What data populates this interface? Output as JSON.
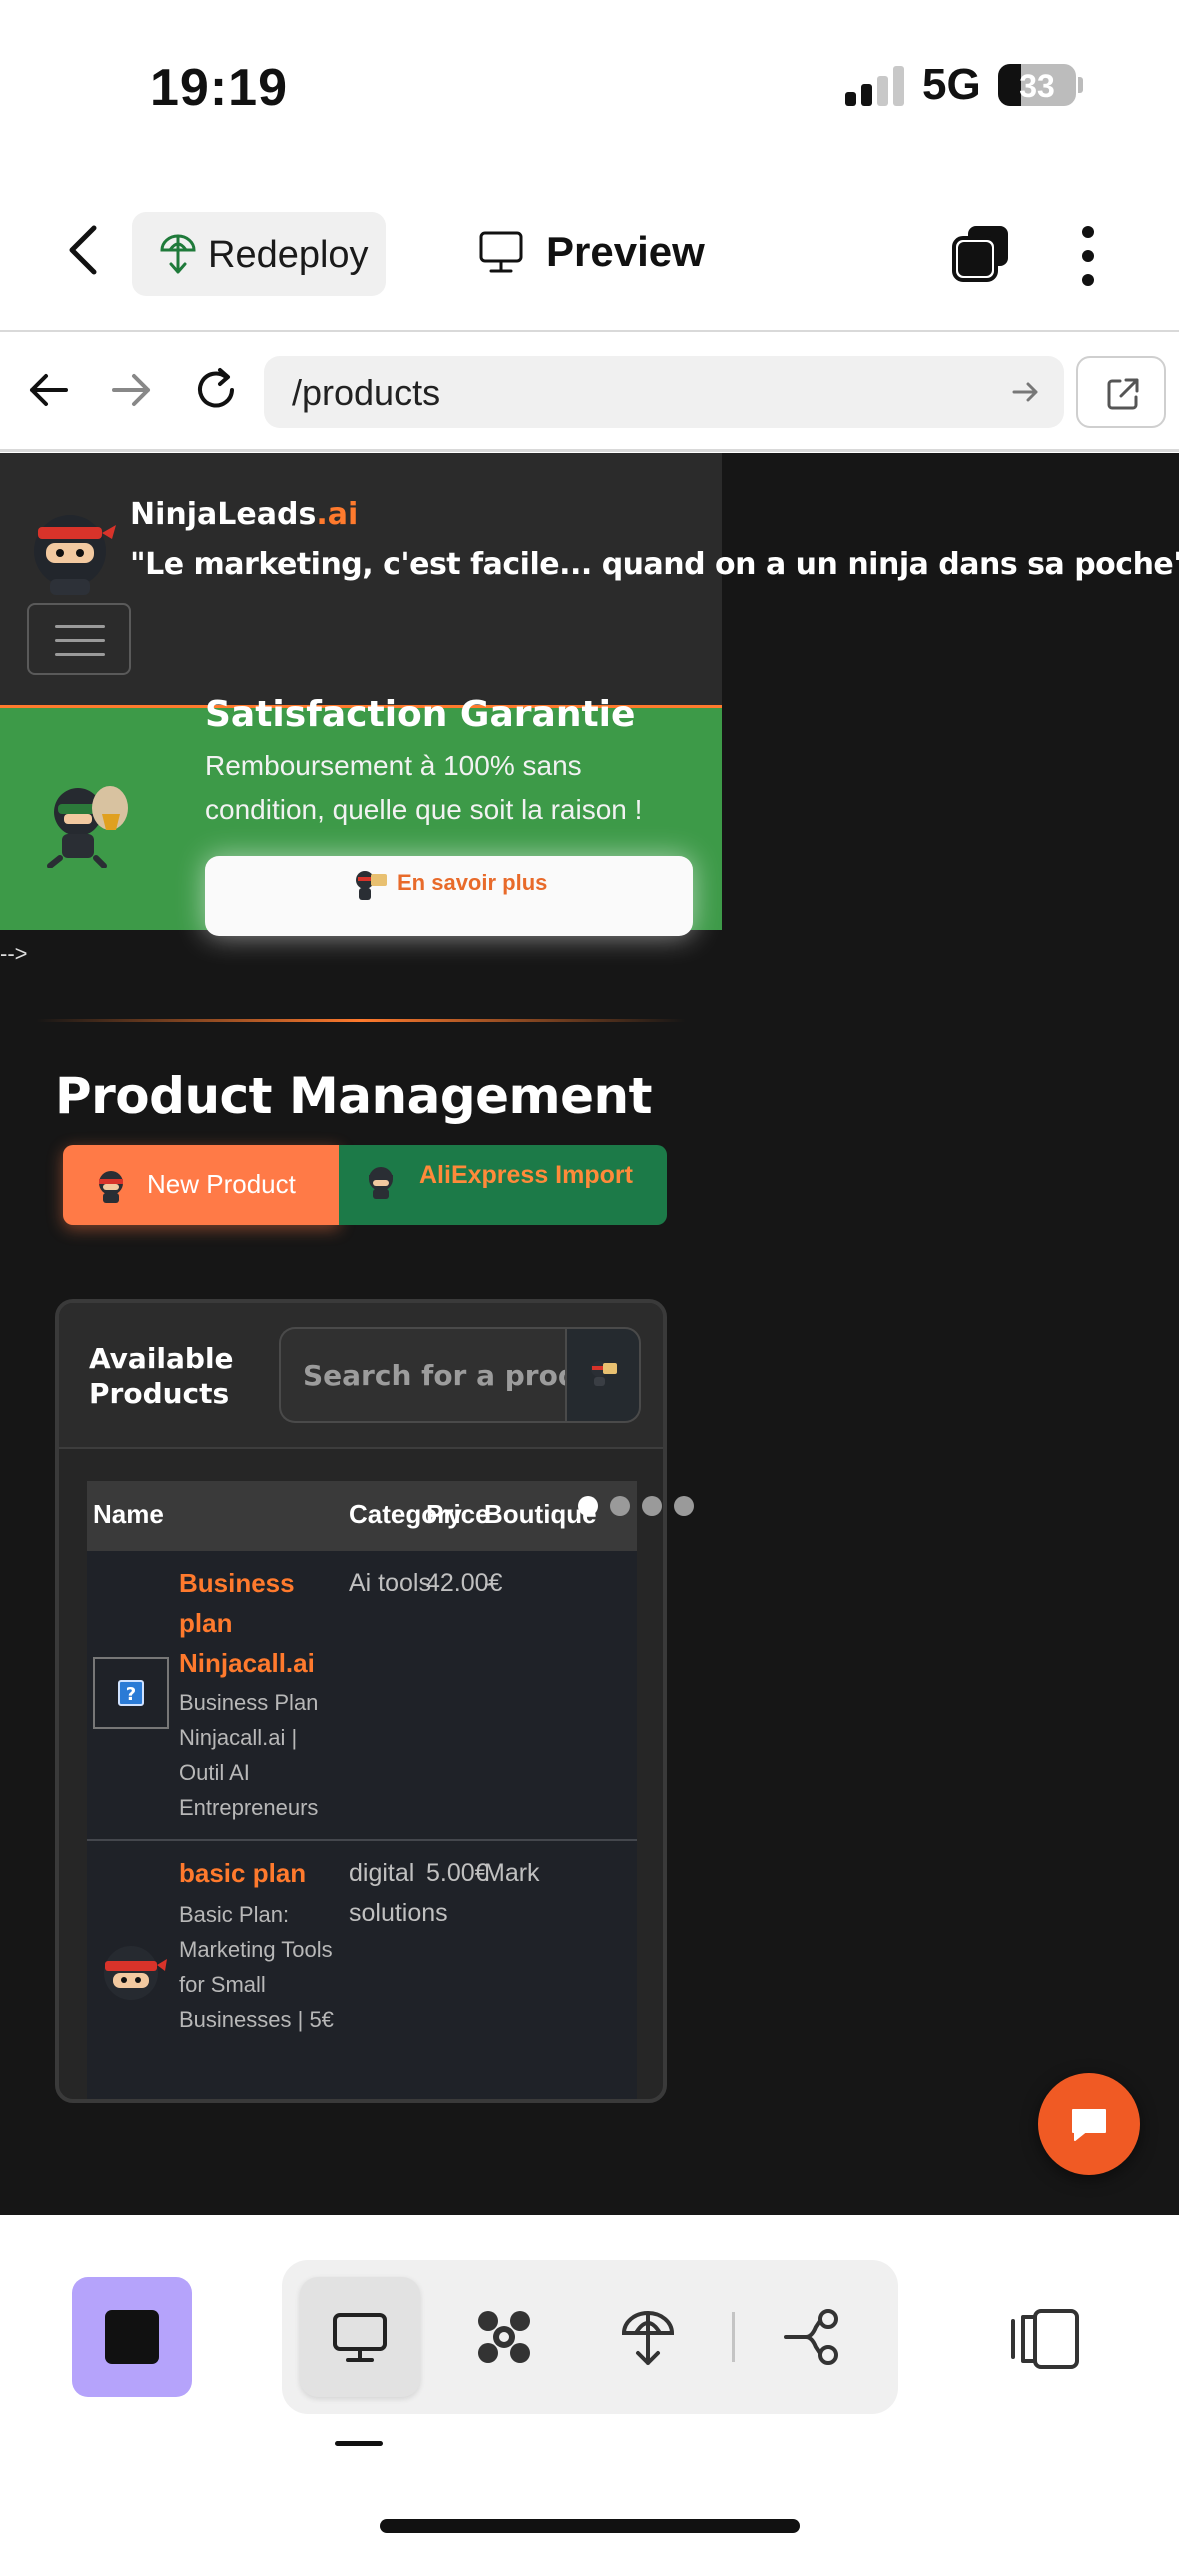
{
  "status_bar": {
    "time": "19:19",
    "network": "5G",
    "battery_percent": "33",
    "signal_bars_active": 2,
    "signal_bars_total": 4
  },
  "app_bar": {
    "redeploy_label": "Redeploy",
    "preview_label": "Preview"
  },
  "browser": {
    "url": "/products"
  },
  "site": {
    "brand_name": "NinjaLeads",
    "brand_suffix": ".ai",
    "tagline": "\"Le marketing, c'est facile... quand on a un ninja dans sa poche\"",
    "promo": {
      "title": "Satisfaction Garantie",
      "text": "Remboursement à 100% sans condition, quelle que soit la raison !",
      "button_label": "En savoir plus"
    },
    "comment_leak": "-->",
    "page_title": "Product Management",
    "new_product_label": "New Product",
    "aliexpress_label": "AliExpress Import",
    "card": {
      "title": "Available Products",
      "search_placeholder": "Search for a product"
    },
    "table": {
      "headers": [
        "Name",
        "Category",
        "Price",
        "Boutique"
      ],
      "rows": [
        {
          "name": "Business plan Ninjacall.ai",
          "description": "Business Plan Ninjacall.ai | Outil AI Entrepreneurs",
          "category": "Ai tools",
          "price": "42.00€",
          "shop": "-",
          "image": "broken-image-icon"
        },
        {
          "name": "basic plan",
          "description": "Basic Plan: Marketing Tools for Small Businesses | 5€",
          "category": "digital solutions",
          "price": "5.00€",
          "shop": "Mark",
          "image": "ninja-avatar"
        }
      ]
    },
    "carousel_dots": {
      "count": 4,
      "active": 0
    }
  },
  "colors": {
    "accent_orange": "#ff7a2d",
    "promo_green": "#3d9a48",
    "aliexpress_green": "#1c7a48",
    "stop_purple": "#b5a3fb",
    "chat_orange": "#f05a24"
  }
}
